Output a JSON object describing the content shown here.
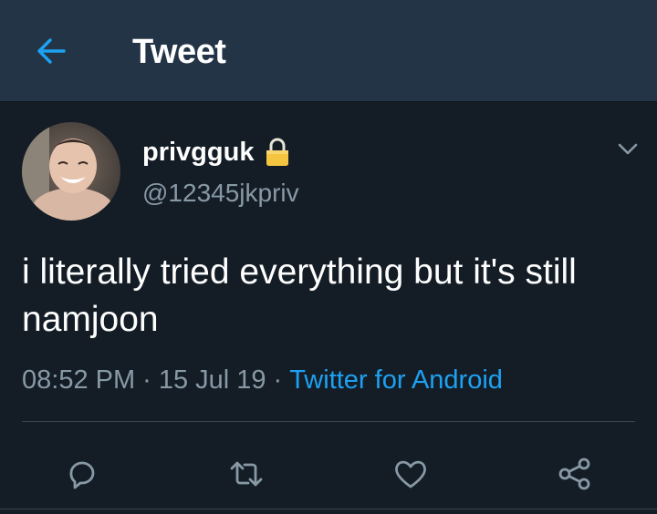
{
  "header": {
    "title": "Tweet",
    "back_icon": "arrow-left-icon",
    "accent_color": "#1da1f2"
  },
  "tweet": {
    "display_name": "privgguk",
    "handle": "@12345jkpriv",
    "protected_icon": "lock-icon",
    "text": "i literally tried everything but it's still namjoon",
    "time": "08:52 PM",
    "separator": "·",
    "date": "15 Jul 19",
    "source": "Twitter for Android"
  },
  "actions": [
    {
      "name": "reply",
      "icon": "reply-icon"
    },
    {
      "name": "retweet",
      "icon": "retweet-icon"
    },
    {
      "name": "like",
      "icon": "heart-icon"
    },
    {
      "name": "share",
      "icon": "share-icon"
    }
  ],
  "colors": {
    "background": "#141d26",
    "header_background": "#243447",
    "secondary_text": "#8899a6",
    "link": "#1da1f2",
    "lock": "#f5c542"
  }
}
